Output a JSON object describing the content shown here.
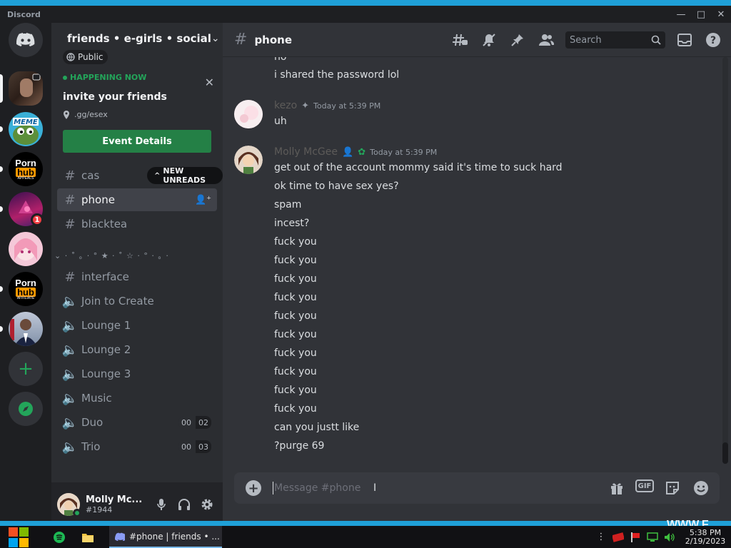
{
  "window": {
    "app_name": "Discord"
  },
  "guild": {
    "name": "friends • e-girls • social",
    "visibility": "Public"
  },
  "event": {
    "status": "HAPPENING NOW",
    "title": "invite your friends",
    "location": ".gg/esex",
    "button": "Event Details"
  },
  "channels": {
    "cas": "cas",
    "new_unreads": "NEW UNREADS",
    "phone": "phone",
    "blacktea": "blacktea",
    "category": "⌄ · ˚ ｡ · ° ★ · ˚ ☆ · ° · ｡ ·",
    "interface": "interface",
    "join": "Join to Create",
    "lounge1": "Lounge 1",
    "lounge2": "Lounge 2",
    "lounge3": "Lounge 3",
    "music": "Music",
    "duo": "Duo",
    "duo_a": "00",
    "duo_b": "02",
    "trio": "Trio",
    "trio_a": "00",
    "trio_b": "03"
  },
  "servers": {
    "badge": "1",
    "porn": "Porn",
    "hub": "hub",
    "sub1": "APPEALS",
    "sub2": "AFFILIATE",
    "meme": "MEME"
  },
  "user": {
    "name": "Molly Mc...",
    "tag": "#1944"
  },
  "header": {
    "channel": "phone",
    "search_placeholder": "Search"
  },
  "messages": {
    "top_partial": "no",
    "shared": "i shared the password lol",
    "kezo_author": "kezo",
    "kezo_time": "Today at 5:39 PM",
    "kezo_text": "uh",
    "molly_author": "Molly McGee",
    "molly_time": "Today at 5:39 PM",
    "lines": [
      "get out of the account mommy said it's time to suck hard",
      "ok time to have sex yes?",
      "spam",
      "incest?",
      "fuck you",
      "fuck you",
      "fuck you",
      "fuck you",
      "fuck you",
      "fuck you",
      "fuck you",
      "fuck you",
      "fuck you",
      "fuck you",
      "can you justt like",
      "?purge 69"
    ]
  },
  "composer": {
    "placeholder": "Message #phone",
    "gif": "GIF"
  },
  "taskbar": {
    "task_label": "#phone | friends • ...",
    "time": "5:38 PM",
    "date": "2/19/2023",
    "watermark": "WWW.F"
  }
}
